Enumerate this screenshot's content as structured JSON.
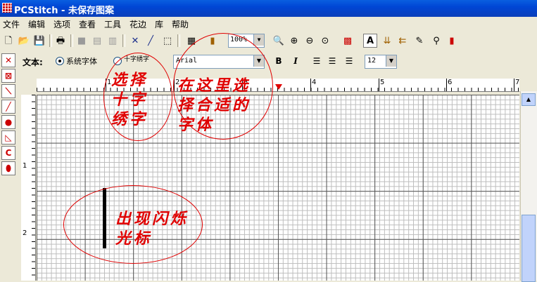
{
  "window": {
    "title": "PCStitch - 未保存图案"
  },
  "menu": [
    "文件",
    "编辑",
    "选项",
    "查看",
    "工具",
    "花边",
    "库",
    "帮助"
  ],
  "toolbar": {
    "zoom": "100%"
  },
  "textbar": {
    "label": "文本:",
    "radio_system": "系统字体",
    "radio_cross": "十字绣字",
    "font": "Arial",
    "bold": "B",
    "italic": "I",
    "size": "12"
  },
  "ruler": {
    "h_labels": [
      "1",
      "2",
      "3",
      "4",
      "5",
      "6",
      "7"
    ],
    "v_labels": [
      "1",
      "2"
    ]
  },
  "annotations": {
    "select_cross": "选择\n十字\n绣字",
    "choose_font": "在这里选\n择合适的\n字体",
    "cursor": "出现闪烁\n光标"
  },
  "colors": {
    "annotation": "#e00000",
    "titlebar": "#0046d5"
  }
}
